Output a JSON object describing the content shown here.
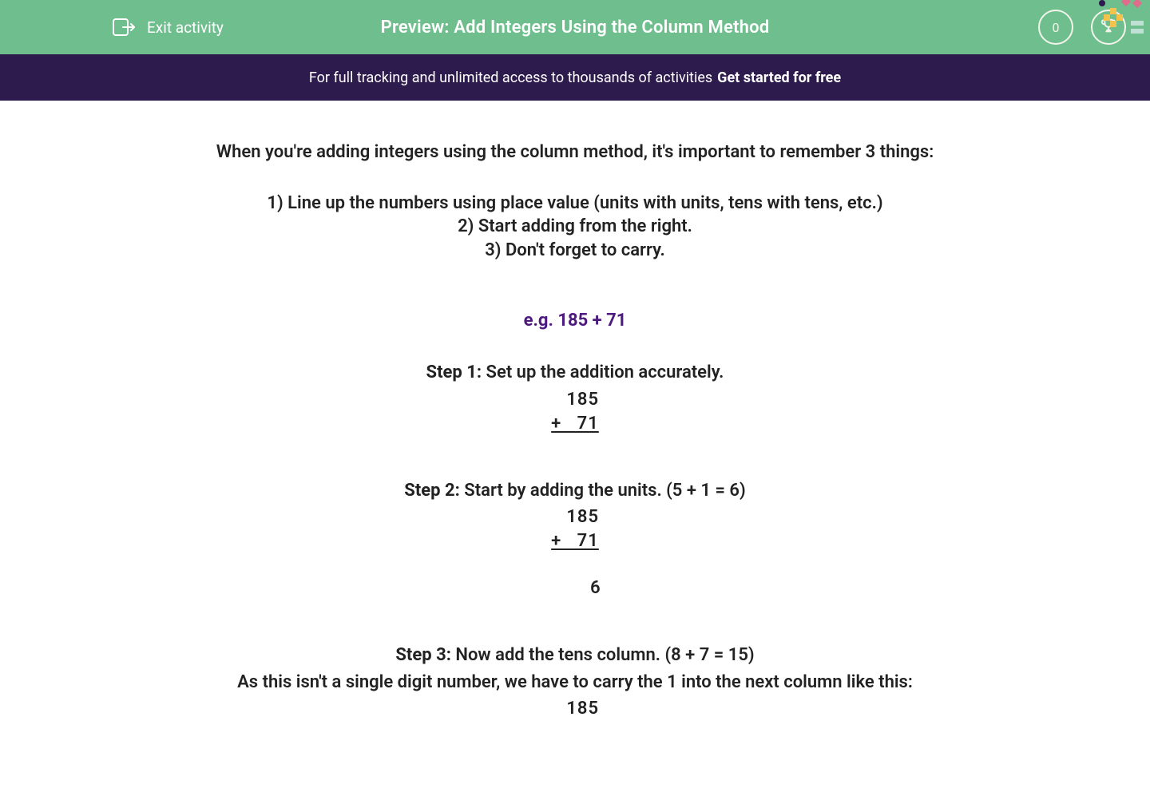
{
  "header": {
    "exit_label": "Exit activity",
    "title": "Preview: Add Integers Using the Column Method",
    "score": "0"
  },
  "promo": {
    "text": "For full tracking and unlimited access to thousands of activities ",
    "cta": "Get started for free"
  },
  "content": {
    "intro": "When you're adding integers using the column method, it's important to remember 3 things:",
    "rules": {
      "r1": "1) Line up the numbers using place value (units with units, tens with tens, etc.)",
      "r2": "2) Start adding from the right.",
      "r3": "3) Don't forget to carry."
    },
    "example_heading": "e.g. 185 + 71",
    "step1": {
      "label": "Step 1:",
      "text": " Set up the addition accurately.",
      "line1": "   185",
      "line2": "+   71"
    },
    "step2": {
      "label": "Step 2:",
      "text": " Start by adding the units. (5 + 1 = 6)",
      "line1": "   185",
      "line2": "+   71",
      "result": "        6"
    },
    "step3": {
      "label": "Step 3:",
      "text": " Now add the tens column. (8 + 7 = 15)",
      "note": "As this isn't a single digit number, we have to carry the 1 into the next column like this:",
      "line1": "   185"
    }
  }
}
